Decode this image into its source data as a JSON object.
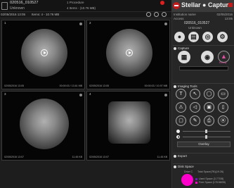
{
  "header": {
    "patient_id": "020516_010527",
    "patient_name": "Unknown",
    "procedure": "1 Procedure",
    "items": "4 Items - (10.76 MB)"
  },
  "brand": {
    "name": "Stellar ● Capture"
  },
  "toolbar": {
    "date": "02/05/2016 13:05",
    "items": "Items: 4 - 10.76 MB"
  },
  "tiles": [
    {
      "num": "1",
      "time": "02/05/2016 13:05",
      "duration": "00:00:03 / 13.61 MB"
    },
    {
      "num": "2",
      "time": "02/05/2016 13:05",
      "duration": "00:00:03 / 10.97 MB"
    },
    {
      "num": "3",
      "time": "02/05/2016 13:07",
      "duration": "11.45 KB"
    },
    {
      "num": "4",
      "time": "02/05/2016 13:07",
      "duration": "11.45 KB"
    }
  ],
  "panel": {
    "institution_label": "Institution name",
    "institution_value": "02/05/2016",
    "access_label": "Access",
    "access_value": "13:05",
    "patient_id": "020516_010527",
    "patient_name": "Unknown",
    "capture": "Capture",
    "ready": "Ready",
    "imaging_tools": "Imaging Tools",
    "overlay": "Overlay",
    "export": "Export",
    "disk_space": "Disk Space",
    "drive": "Drive C",
    "total_space": "Total Space(TB)(19.26)",
    "used_space": "Used Space (3.77GB)",
    "free_space": "Free Space (178.58GB)"
  },
  "icons": {
    "tool_glyphs": [
      "T",
      "↖",
      "◯",
      "▭",
      "⚠",
      "◁",
      "▣",
      "▯",
      "▢",
      "✎",
      "⎙",
      "⦿"
    ]
  },
  "colors": {
    "accent": "#c41a1a",
    "disk_used": "#6a1ab8",
    "disk_free": "#ff00cc"
  }
}
